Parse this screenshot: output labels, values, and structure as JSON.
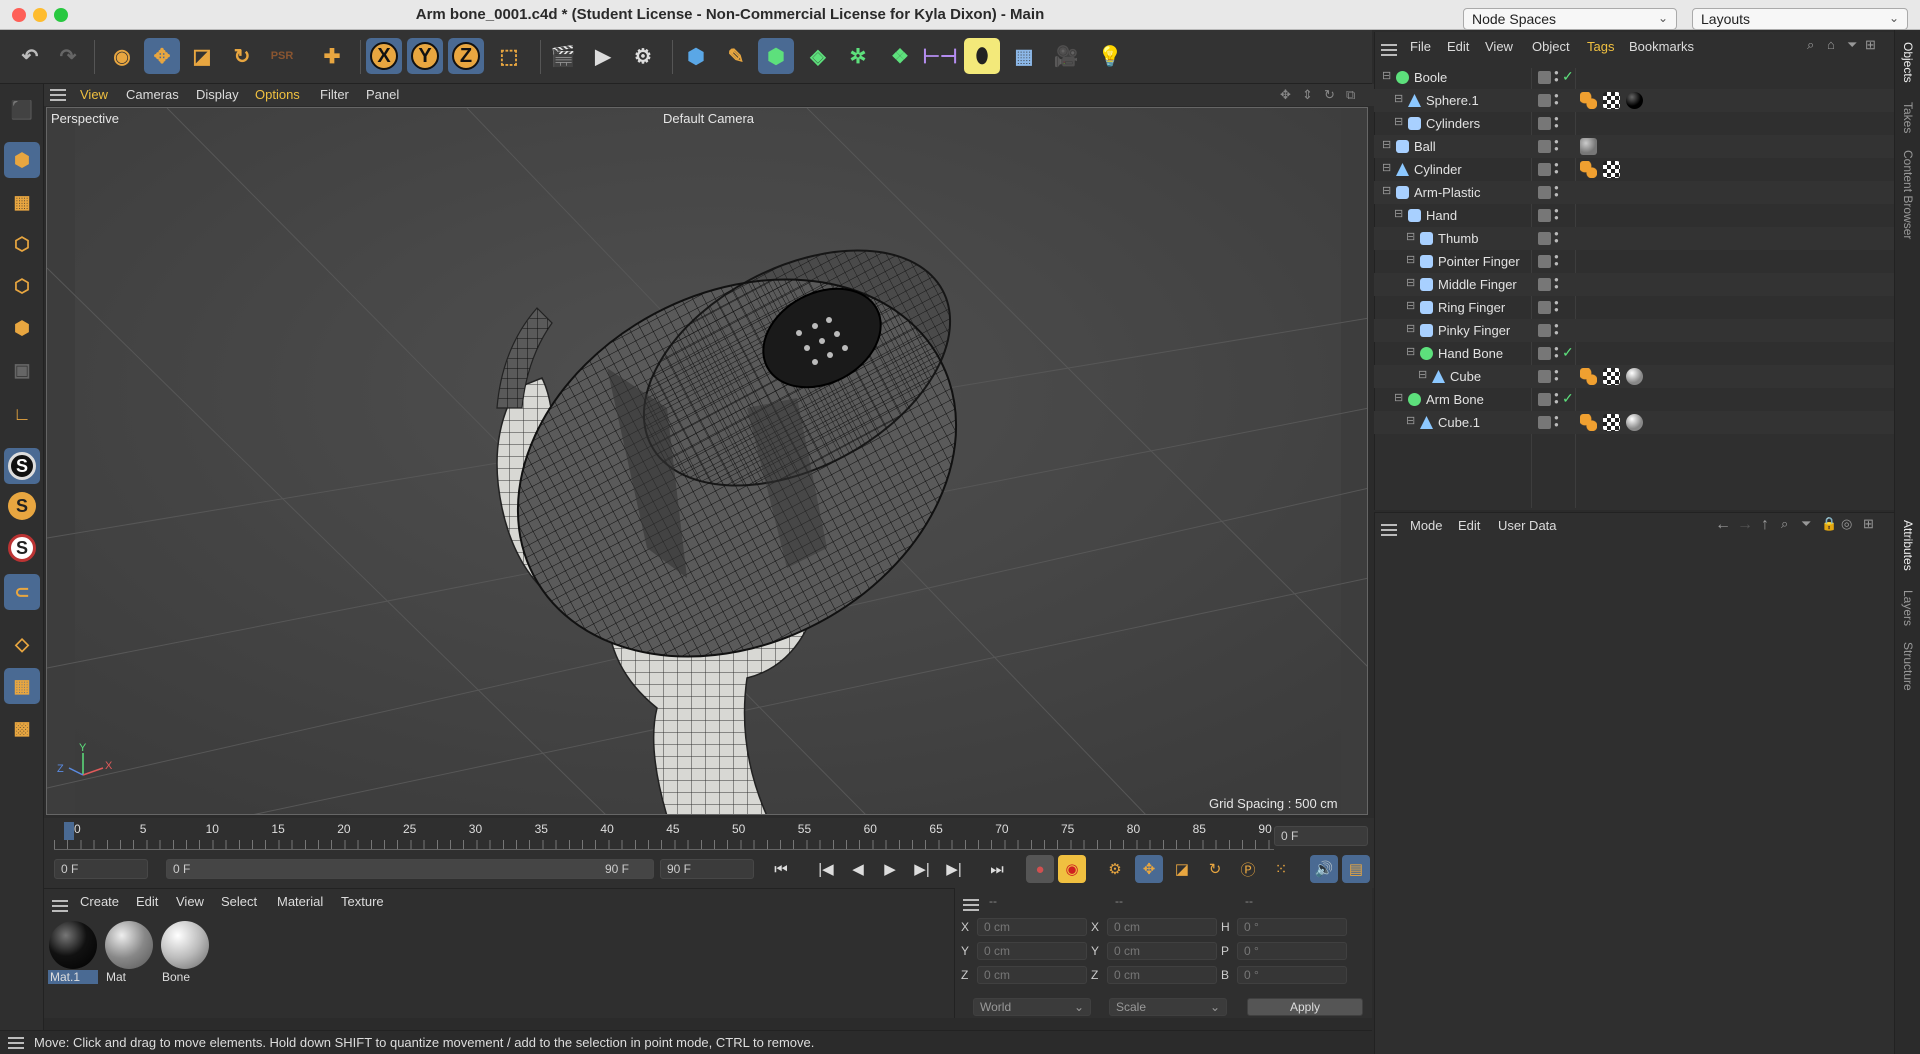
{
  "window": {
    "title": "Arm bone_0001.c4d * (Student License - Non-Commercial License for Kyla Dixon) - Main",
    "node_spaces": "Node Spaces",
    "layouts": "Layouts"
  },
  "toolbar": {
    "icons": [
      "undo-icon",
      "redo-icon",
      "select-icon",
      "move-icon",
      "scale-icon",
      "rotate-icon",
      "psr-icon",
      "add-icon",
      "x-axis-icon",
      "y-axis-icon",
      "z-axis-icon",
      "world-coords-icon",
      "render-region-icon",
      "render-view-icon",
      "render-settings-icon",
      "cube-icon",
      "pen-icon",
      "subdivision-icon",
      "extrude-icon",
      "cloner-icon",
      "array-icon",
      "symmetry-icon",
      "deformer-icon",
      "floor-icon",
      "camera-icon",
      "light-icon"
    ],
    "axis_x": "X",
    "axis_y": "Y",
    "axis_z": "Z"
  },
  "left_tools": {
    "s1": "S",
    "s2": "S",
    "s3": "S"
  },
  "viewport": {
    "menu": [
      "View",
      "Cameras",
      "Display",
      "Options",
      "Filter",
      "Panel"
    ],
    "label": "Perspective",
    "camera": "Default Camera",
    "grid_spacing": "Grid Spacing : 500 cm",
    "axis_x": "X",
    "axis_y": "Y",
    "axis_z": "Z"
  },
  "timeline": {
    "ticks": [
      "0",
      "5",
      "10",
      "15",
      "20",
      "25",
      "30",
      "35",
      "40",
      "45",
      "50",
      "55",
      "60",
      "65",
      "70",
      "75",
      "80",
      "85",
      "90"
    ],
    "current_frame": "0 F",
    "start_frame": "0 F",
    "range_start": "0 F",
    "range_end": "90 F",
    "end_frame": "90 F"
  },
  "materials": {
    "menu": [
      "Create",
      "Edit",
      "View",
      "Select",
      "Material",
      "Texture"
    ],
    "items": [
      {
        "name": "Mat.1",
        "selected": true
      },
      {
        "name": "Mat",
        "selected": false
      },
      {
        "name": "Bone",
        "selected": false
      }
    ]
  },
  "coords": {
    "headers": [
      "--",
      "--",
      "--"
    ],
    "rows": [
      {
        "l1": "X",
        "v1": "0 cm",
        "l2": "X",
        "v2": "0 cm",
        "l3": "H",
        "v3": "0 °"
      },
      {
        "l1": "Y",
        "v1": "0 cm",
        "l2": "Y",
        "v2": "0 cm",
        "l3": "P",
        "v3": "0 °"
      },
      {
        "l1": "Z",
        "v1": "0 cm",
        "l2": "Z",
        "v2": "0 cm",
        "l3": "B",
        "v3": "0 °"
      }
    ],
    "world": "World",
    "scale": "Scale",
    "apply": "Apply"
  },
  "status": "Move: Click and drag to move elements. Hold down SHIFT to quantize movement / add to the selection in point mode, CTRL to remove.",
  "objects": {
    "menu": [
      "File",
      "Edit",
      "View",
      "Object",
      "Tags",
      "Bookmarks"
    ],
    "active_menu": "Tags",
    "rows": [
      {
        "name": "Boole",
        "depth": 0,
        "icon": "boole",
        "check": true,
        "tags": []
      },
      {
        "name": "Sphere.1",
        "depth": 1,
        "icon": "poly",
        "check": false,
        "tags": [
          "phong",
          "uv",
          "mat-black"
        ]
      },
      {
        "name": "Cylinders",
        "depth": 1,
        "icon": "null",
        "check": false,
        "tags": []
      },
      {
        "name": "Ball",
        "depth": 0,
        "icon": "null",
        "check": false,
        "tags": [
          "mat-glass"
        ]
      },
      {
        "name": "Cylinder",
        "depth": 0,
        "icon": "poly",
        "check": false,
        "tags": [
          "phong",
          "uv"
        ]
      },
      {
        "name": "Arm-Plastic",
        "depth": 0,
        "icon": "null",
        "check": false,
        "tags": []
      },
      {
        "name": "Hand",
        "depth": 1,
        "icon": "null",
        "check": false,
        "tags": []
      },
      {
        "name": "Thumb",
        "depth": 2,
        "icon": "null",
        "check": false,
        "tags": []
      },
      {
        "name": "Pointer Finger",
        "depth": 2,
        "icon": "null",
        "check": false,
        "tags": []
      },
      {
        "name": "Middle Finger",
        "depth": 2,
        "icon": "null",
        "check": false,
        "tags": []
      },
      {
        "name": "Ring Finger",
        "depth": 2,
        "icon": "null",
        "check": false,
        "tags": []
      },
      {
        "name": "Pinky Finger",
        "depth": 2,
        "icon": "null",
        "check": false,
        "tags": []
      },
      {
        "name": "Hand Bone",
        "depth": 2,
        "icon": "boole",
        "check": true,
        "tags": []
      },
      {
        "name": "Cube",
        "depth": 3,
        "icon": "poly",
        "check": false,
        "tags": [
          "phong",
          "uv",
          "mat-white"
        ]
      },
      {
        "name": "Arm Bone",
        "depth": 1,
        "icon": "boole",
        "check": true,
        "tags": []
      },
      {
        "name": "Cube.1",
        "depth": 2,
        "icon": "poly",
        "check": false,
        "tags": [
          "phong",
          "uv",
          "mat-white"
        ]
      }
    ]
  },
  "attributes": {
    "menu": [
      "Mode",
      "Edit",
      "User Data"
    ]
  },
  "side_tabs": {
    "top": [
      "Objects",
      "Takes",
      "Content Browser"
    ],
    "bottom": [
      "Attributes",
      "Layers",
      "Structure"
    ]
  },
  "colors": {
    "accent": "#4a6a93",
    "active_menu": "#f0c040",
    "orange": "#e8a640"
  }
}
